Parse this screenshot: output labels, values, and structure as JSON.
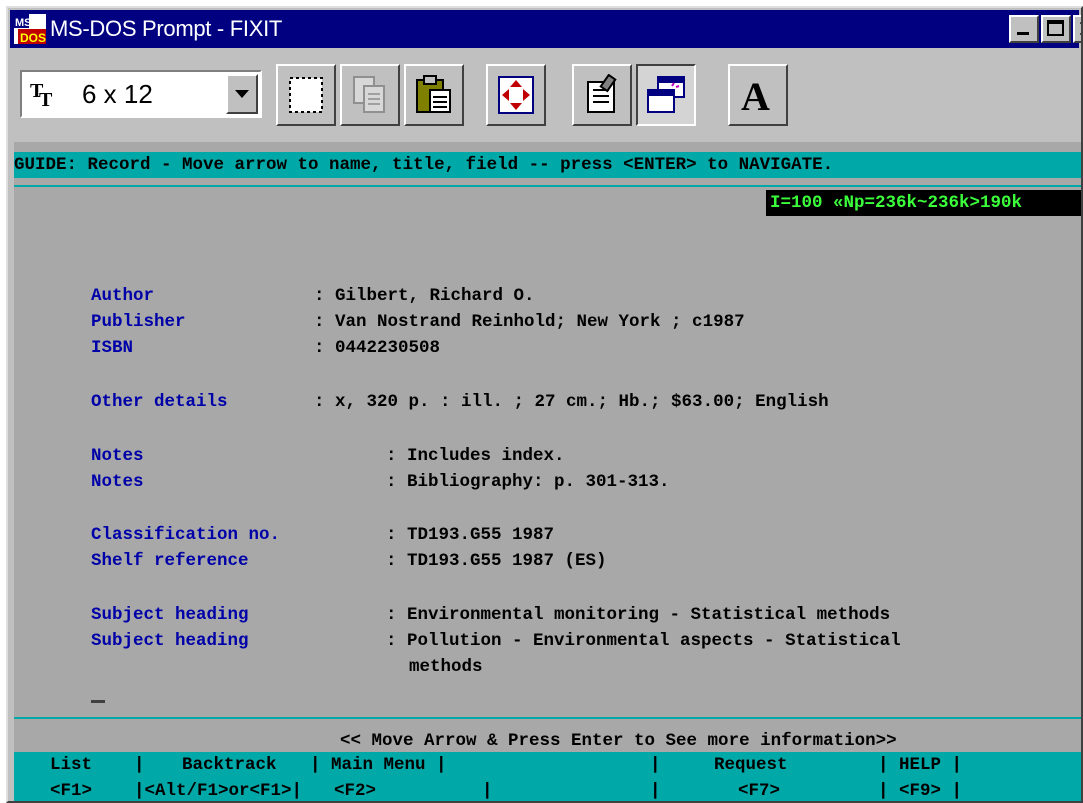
{
  "window": {
    "title": "MS-DOS Prompt - FIXIT"
  },
  "toolbar": {
    "font_size": "6 x 12",
    "tools": [
      "mark-icon",
      "copy-icon",
      "paste-icon",
      "fullscreen-icon",
      "properties-icon",
      "background-icon",
      "font-icon"
    ],
    "font_button_label": "A"
  },
  "screen": {
    "guide": "GUIDE: Record - Move arrow to name, title, field -- press <ENTER> to NAVIGATE.",
    "status": "I=100 «Np=236k~236k>190k",
    "fields": [
      {
        "label": "Author",
        "value": ": Gilbert, Richard O."
      },
      {
        "label": "Publisher",
        "value": ": Van Nostrand Reinhold; New York ; c1987"
      },
      {
        "label": "ISBN",
        "value": ": 0442230508"
      },
      {
        "label": "Other details",
        "value": ": x, 320 p. : ill. ; 27 cm.; Hb.; $63.00; English"
      },
      {
        "label": "Notes",
        "value": ": Includes index."
      },
      {
        "label": "Notes",
        "value": ": Bibliography: p. 301-313."
      },
      {
        "label": "Classification no.",
        "value": ": TD193.G55 1987"
      },
      {
        "label": "Shelf reference",
        "value": ": TD193.G55 1987 (ES)"
      },
      {
        "label": "Subject heading",
        "value": ": Environmental monitoring - Statistical methods"
      },
      {
        "label": "Subject heading",
        "value": ": Pollution - Environmental aspects - Statistical"
      },
      {
        "label": "",
        "value": "methods"
      }
    ],
    "hint": "<< Move Arrow & Press Enter to See more information>>",
    "function_keys": {
      "labels": [
        "List",
        "|",
        "Backtrack",
        "| Main Menu |",
        "|",
        "Request",
        "| HELP |"
      ],
      "keys": [
        "<F1>",
        "|<Alt/F1>or<F1>|",
        "<F2>",
        "|",
        "|",
        "<F7>",
        "| <F9> |"
      ]
    }
  },
  "colors": {
    "title_bar": "#000080",
    "screen_bg": "#a8a8a8",
    "cyan_bar": "#00a8a8",
    "label_blue": "#0000a8",
    "status_green": "#3cff3c"
  }
}
